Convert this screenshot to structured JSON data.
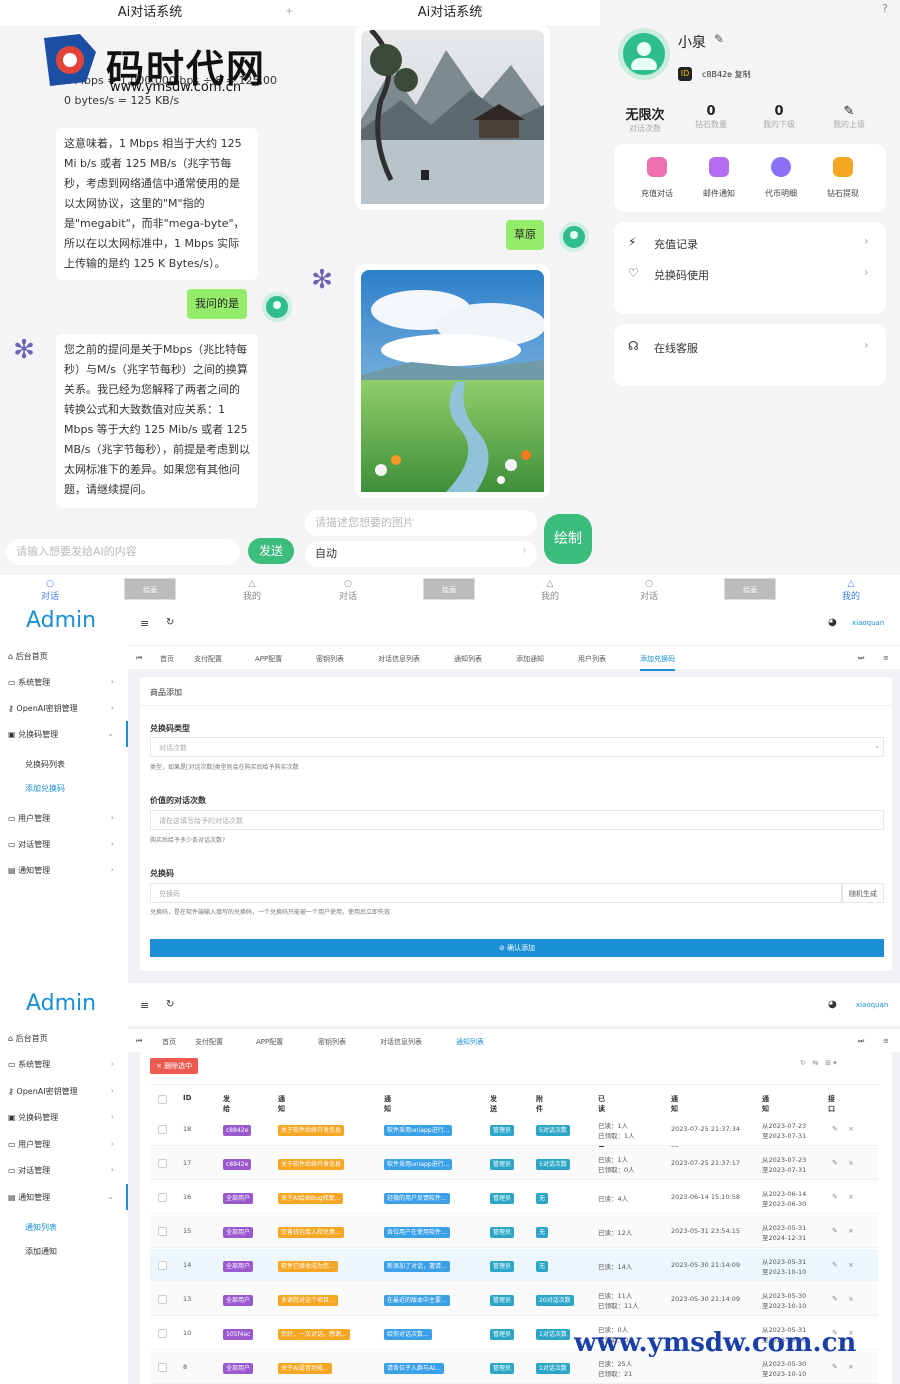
{
  "chat_left": {
    "title": "Ai对话系统",
    "partial_text_1": "1 Mbps = 1,000,000 bps ÷ 8 = 125,00",
    "partial_text_2": "0 bytes/s = 125 KB/s",
    "ai_msg_1": "这意味着，1 Mbps 相当于大约 125 Mi b/s 或者 125 MB/s（兆字节每秒，考虑到网络通信中通常使用的是以太网协议，这里的\"M\"指的是\"megabit\"，而非\"mega-byte\"，所以在以太网标准中，1 Mbps 实际上传输的是约 125 K Bytes/s）。",
    "user_msg": "我问的是",
    "ai_msg_2": "您之前的提问是关于Mbps（兆比特每秒）与M/s（兆字节每秒）之间的换算关系。我已经为您解释了两者之间的转换公式和大致数值对应关系：1 Mbps 等于大约 125 Mib/s 或者 125 MB/s（兆字节每秒），前提是考虑到以太网标准下的差异。如果您有其他问题，请继续提问。",
    "input_placeholder": "请输入想要发给AI的内容",
    "send_label": "发送"
  },
  "chat_middle": {
    "title": "Ai对话系统",
    "user_msg": "草原",
    "draw_placeholder": "请描述您想要的图片",
    "mode_value": "自动",
    "draw_label": "绘制"
  },
  "profile": {
    "name": "小泉",
    "id_text": "c8B42e 复制",
    "stats": [
      {
        "value": "无限次",
        "label": "对话次数"
      },
      {
        "value": "0",
        "label": "钻石数量"
      },
      {
        "value": "0",
        "label": "我的下级"
      },
      {
        "value": "",
        "label": "我的上级"
      }
    ],
    "quick": [
      {
        "label": "充值对话",
        "color": "#ee6fb0"
      },
      {
        "label": "邮件通知",
        "color": "#b36bf0"
      },
      {
        "label": "代币明细",
        "color": "#8a70f5"
      },
      {
        "label": "钻石提现",
        "color": "#f5a623"
      }
    ],
    "rows": [
      "充值记录",
      "兑换码使用"
    ],
    "service": "在线客服"
  },
  "navbar": {
    "items": [
      "对话",
      "绘画",
      "我的",
      "对话",
      "绘画",
      "我的",
      "对话",
      "绘画",
      "我的"
    ]
  },
  "admin1": {
    "logo": "Admin",
    "user": "xiaoquan",
    "menu": [
      "后台首页",
      "系统管理",
      "OpenAI密钥管理",
      "兑换码管理",
      "用户管理",
      "对话管理",
      "通知管理"
    ],
    "sub": [
      "兑换码列表",
      "添加兑换码"
    ],
    "tabs": [
      "首页",
      "支付配置",
      "APP配置",
      "密钥列表",
      "对话信息列表",
      "通知列表",
      "添加通知",
      "用户列表",
      "添加兑换码"
    ],
    "panel_title": "商品添加",
    "f1_label": "兑换码类型",
    "f1_value": "对话次数",
    "f1_help": "类型，如果是[对话次数]类型则会在购买后给予购买次数",
    "f2_label": "价值的对话次数",
    "f2_placeholder": "请在这填写给予的对话次数",
    "f2_help": "购买后给予多少条对话次数?",
    "f3_label": "兑换码",
    "f3_placeholder": "兑换码",
    "f3_btn": "随机生成",
    "f3_help": "兑换码，是在软件端输入填写的兑换码，一个兑换码只能被一个用户使用，使用后立即失效",
    "submit": "⊘ 确认添加"
  },
  "admin2": {
    "logo": "Admin",
    "user": "xiaoquan",
    "menu": [
      "后台首页",
      "系统管理",
      "OpenAI密钥管理",
      "兑换码管理",
      "用户管理",
      "对话管理",
      "通知管理"
    ],
    "sub": [
      "通知列表",
      "添加通知"
    ],
    "tabs": [
      "首页",
      "支付配置",
      "APP配置",
      "密钥列表",
      "对话信息列表",
      "通知列表"
    ],
    "delete_btn": "× 删除选中",
    "headers": [
      "ID",
      "发给谁的",
      "通知标题",
      "通知内容",
      "发送者",
      "附件内容",
      "已读用户数量",
      "通知添加时间",
      "通知有效期",
      "接口操作"
    ],
    "rows": [
      {
        "id": "18",
        "to": "c8842e",
        "title": "关于软件后续开发信息",
        "content": "软件采用uniapp进行...",
        "sender": "管理员",
        "attach": "5对话次数",
        "read": "已读：1人",
        "read2": "已领取：1人",
        "time": "2023-07-25 21:37:34",
        "valid": "从2023-07-23",
        "valid2": "至2023-07-31"
      },
      {
        "id": "17",
        "to": "c8842e",
        "title": "关于软件后续开发信息",
        "content": "软件采用uniapp进行...",
        "sender": "管理员",
        "attach": "5对话次数",
        "read": "已读：1人",
        "read2": "已领取：0人",
        "time": "2023-07-25 21:37:17",
        "valid": "从2023-07-23",
        "valid2": "至2023-07-31"
      },
      {
        "id": "16",
        "to": "全部用户",
        "title": "关于AI绘画Bug修复...",
        "content": "轻微的用户反馈软件...",
        "sender": "管理员",
        "attach": "无",
        "read": "已读：4人",
        "read2": "",
        "time": "2023-06-14 15:10:58",
        "valid": "从2023-06-14",
        "valid2": "至2023-06-30"
      },
      {
        "id": "15",
        "to": "全部用户",
        "title": "完善钱包接入和兑换...",
        "content": "各位用户在使用软件...",
        "sender": "管理员",
        "attach": "无",
        "read": "已读：12人",
        "read2": "",
        "time": "2023-05-31 23:54:15",
        "valid": "从2023-05-31",
        "valid2": "至2024-12-31"
      },
      {
        "id": "14",
        "to": "全部用户",
        "title": "软件已接收成为您...",
        "content": "新添加了对话，邀请...",
        "sender": "管理员",
        "attach": "无",
        "read": "已读：14人",
        "read2": "",
        "time": "2023-05-30 21:14:09",
        "valid": "从2023-05-31",
        "valid2": "至2023-10-10"
      },
      {
        "id": "13",
        "to": "全部用户",
        "title": "多谢您对这个项目...",
        "content": "在最近的版本中主要...",
        "sender": "管理员",
        "attach": "20对话次数",
        "read": "已读：11人",
        "read2": "已领取：11人",
        "time": "2023-05-30 21:14:09",
        "valid": "从2023-05-30",
        "valid2": "至2023-10-10"
      },
      {
        "id": "10",
        "to": "105f4ac",
        "title": "你好，一次对话，感谢...",
        "content": "给你对话次数...",
        "sender": "管理员",
        "attach": "1对话次数",
        "read": "已读：0人",
        "read2": "已领取：0人",
        "time": "",
        "valid": "从2023-05-31",
        "valid2": "至2023-10-10"
      },
      {
        "id": "8",
        "to": "全部用户",
        "title": "关于AI语音功能...",
        "content": "请各位子入群与AI...",
        "sender": "管理员",
        "attach": "1对话次数",
        "read": "已读：25人",
        "read2": "已领取：21",
        "time": "",
        "valid": "从2023-05-30",
        "valid2": "至2023-10-10"
      }
    ]
  },
  "watermark": {
    "top_logo": "码时代网",
    "top_url": "www.ymsdw.com.cn",
    "bottom_url": "www.ymsdw.com.cn"
  }
}
